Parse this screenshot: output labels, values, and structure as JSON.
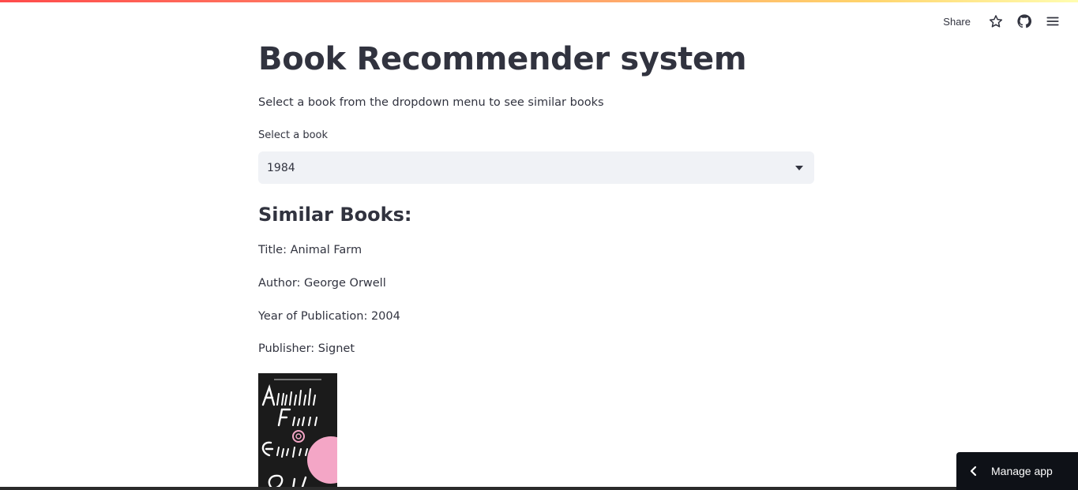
{
  "header": {
    "share_label": "Share",
    "icons": [
      "star-icon",
      "github-icon",
      "hamburger-menu-icon"
    ]
  },
  "main": {
    "title": "Book Recommender system",
    "subtitle": "Select a book from the dropdown menu to see similar books",
    "select": {
      "label": "Select a book",
      "value": "1984"
    },
    "similar_heading": "Similar Books:",
    "result": {
      "title_line": "Title: Animal Farm",
      "author_line": "Author: George Orwell",
      "year_line": "Year of Publication: 2004",
      "publisher_line": "Publisher: Signet",
      "cover_text": "Animal Farm George Orwell"
    }
  },
  "footer": {
    "manage_app_label": "Manage app"
  },
  "colors": {
    "text": "#31333f",
    "select_bg": "#f0f2f6",
    "manage_bg": "#0e1117",
    "cover_bg": "#1b1b1b",
    "cover_accent": "#f4a6c6"
  }
}
